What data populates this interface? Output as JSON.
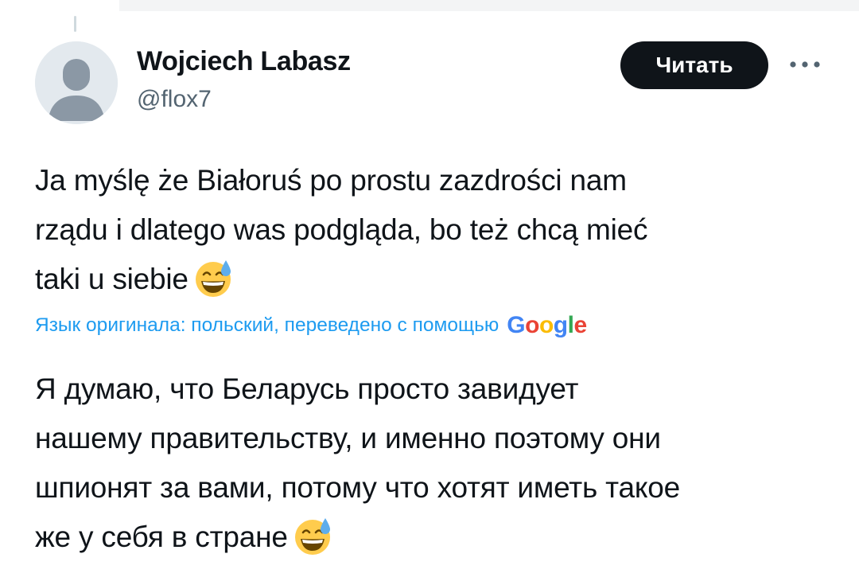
{
  "tweet": {
    "author_name": "Wojciech Labasz",
    "handle": "@flox7",
    "follow_label": "Читать",
    "original_lines": [
      "Ja myślę że Białoruś po prostu zazdrości nam",
      "rządu i dlatego was podgląda, bo też chcą mieć",
      "taki u siebie"
    ],
    "translation_note": "Язык оригинала: польский, переведено с помощью",
    "translation_brand": [
      "G",
      "o",
      "o",
      "g",
      "l",
      "e"
    ],
    "translated_lines": [
      "Я думаю, что Беларусь просто завидует",
      "нашему правительству, и именно поэтому они",
      "шпионят за вами, потому что хотят иметь такое",
      "же у себя в стране"
    ],
    "emoji": "grinning-face-with-sweat"
  },
  "icons": {
    "more": "more-horizontal-icon",
    "avatar": "default-avatar-icon"
  },
  "colors": {
    "text": "#0f1419",
    "secondary": "#536471",
    "link": "#1d9bf0",
    "button_bg": "#0f1419",
    "button_text": "#ffffff"
  }
}
